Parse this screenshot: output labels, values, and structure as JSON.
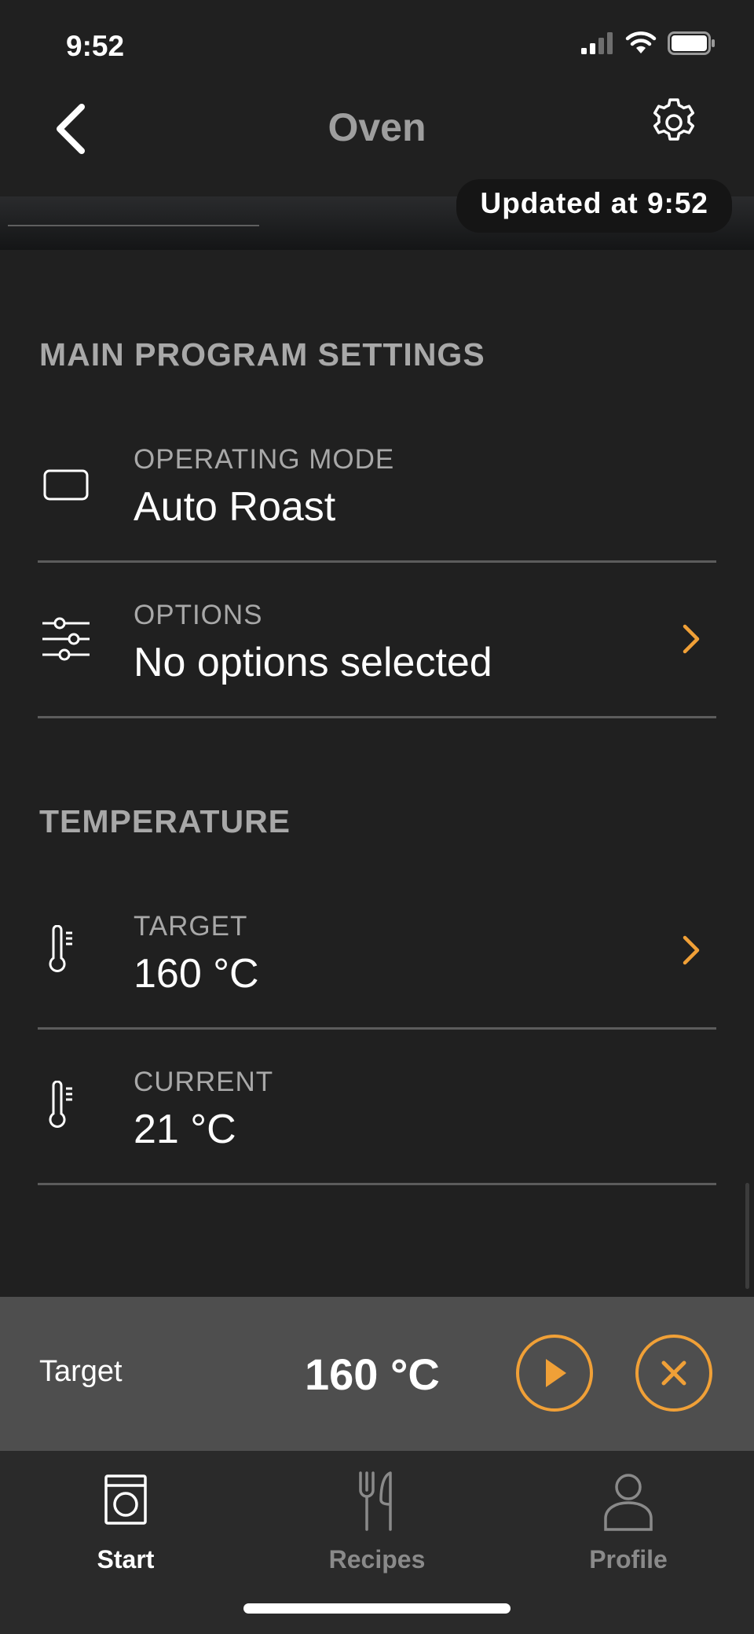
{
  "status_bar": {
    "time": "9:52"
  },
  "nav": {
    "title": "Oven"
  },
  "camera": {
    "updated_text": "Updated at 9:52"
  },
  "sections": {
    "main_program": {
      "heading": "MAIN PROGRAM SETTINGS",
      "operating_mode": {
        "label": "OPERATING MODE",
        "value": "Auto Roast"
      },
      "options": {
        "label": "OPTIONS",
        "value": "No options selected"
      }
    },
    "temperature": {
      "heading": "TEMPERATURE",
      "target": {
        "label": "TARGET",
        "value": "160 °C"
      },
      "current": {
        "label": "CURRENT",
        "value": "21 °C"
      }
    }
  },
  "bottom_panel": {
    "label": "Target",
    "value": "160 °C"
  },
  "tabs": [
    {
      "label": "Start",
      "icon": "washer-icon",
      "active": true
    },
    {
      "label": "Recipes",
      "icon": "fork-knife-icon",
      "active": false
    },
    {
      "label": "Profile",
      "icon": "person-icon",
      "active": false
    }
  ],
  "colors": {
    "accent": "#f0a037",
    "background": "#202020",
    "panel": "#4e4e4e",
    "tabbar": "#2a2a2a"
  }
}
